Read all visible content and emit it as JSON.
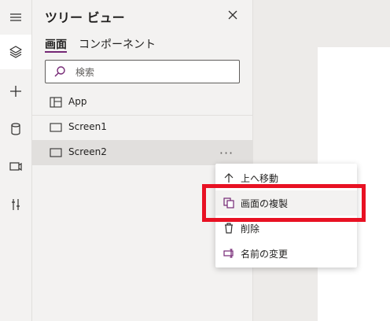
{
  "rail": {
    "items": [
      {
        "icon": "hamburger-menu-icon"
      },
      {
        "icon": "layers-icon"
      },
      {
        "icon": "plus-icon"
      },
      {
        "icon": "database-icon"
      },
      {
        "icon": "media-icon"
      },
      {
        "icon": "tools-icon"
      }
    ]
  },
  "panel": {
    "title": "ツリー ビュー",
    "tabs": [
      {
        "label": "画面"
      },
      {
        "label": "コンポーネント"
      }
    ],
    "search": {
      "placeholder": "検索"
    },
    "tree": [
      {
        "label": "App",
        "icon": "app-icon"
      },
      {
        "label": "Screen1",
        "icon": "screen-icon"
      },
      {
        "label": "Screen2",
        "icon": "screen-icon"
      }
    ],
    "more_label": "···"
  },
  "context_menu": {
    "items": [
      {
        "label": "上へ移動",
        "icon": "arrow-up-icon"
      },
      {
        "label": "画面の複製",
        "icon": "copy-icon"
      },
      {
        "label": "削除",
        "icon": "trash-icon"
      },
      {
        "label": "名前の変更",
        "icon": "rename-icon"
      }
    ]
  },
  "colors": {
    "accent": "#742774",
    "annotation": "#e81123"
  }
}
